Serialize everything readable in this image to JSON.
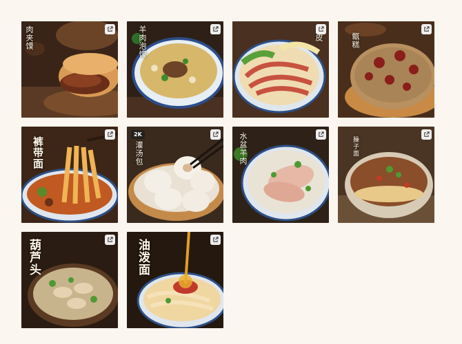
{
  "gallery": {
    "items": [
      {
        "title": "肉夹馍",
        "style": "sm",
        "selected": false,
        "badge": ""
      },
      {
        "title": "羊肉泡馍",
        "style": "sm",
        "selected": false,
        "badge": ""
      },
      {
        "title": "凉皮",
        "style": "sm",
        "selected": false,
        "badge": ""
      },
      {
        "title": "甑糕",
        "style": "sm",
        "selected": false,
        "badge": ""
      },
      {
        "title": "裤带面",
        "style": "md",
        "selected": false,
        "badge": ""
      },
      {
        "title": "灌汤包",
        "style": "sm",
        "selected": true,
        "badge": "2K"
      },
      {
        "title": "水盆羊肉",
        "style": "sm",
        "selected": false,
        "badge": ""
      },
      {
        "title": "臊子面",
        "style": "sm",
        "selected": false,
        "badge": ""
      },
      {
        "title": "葫芦头",
        "style": "lg",
        "selected": false,
        "badge": ""
      },
      {
        "title": "油泼面",
        "style": "lg",
        "selected": false,
        "badge": ""
      }
    ],
    "open_icon": "external-link-icon"
  }
}
